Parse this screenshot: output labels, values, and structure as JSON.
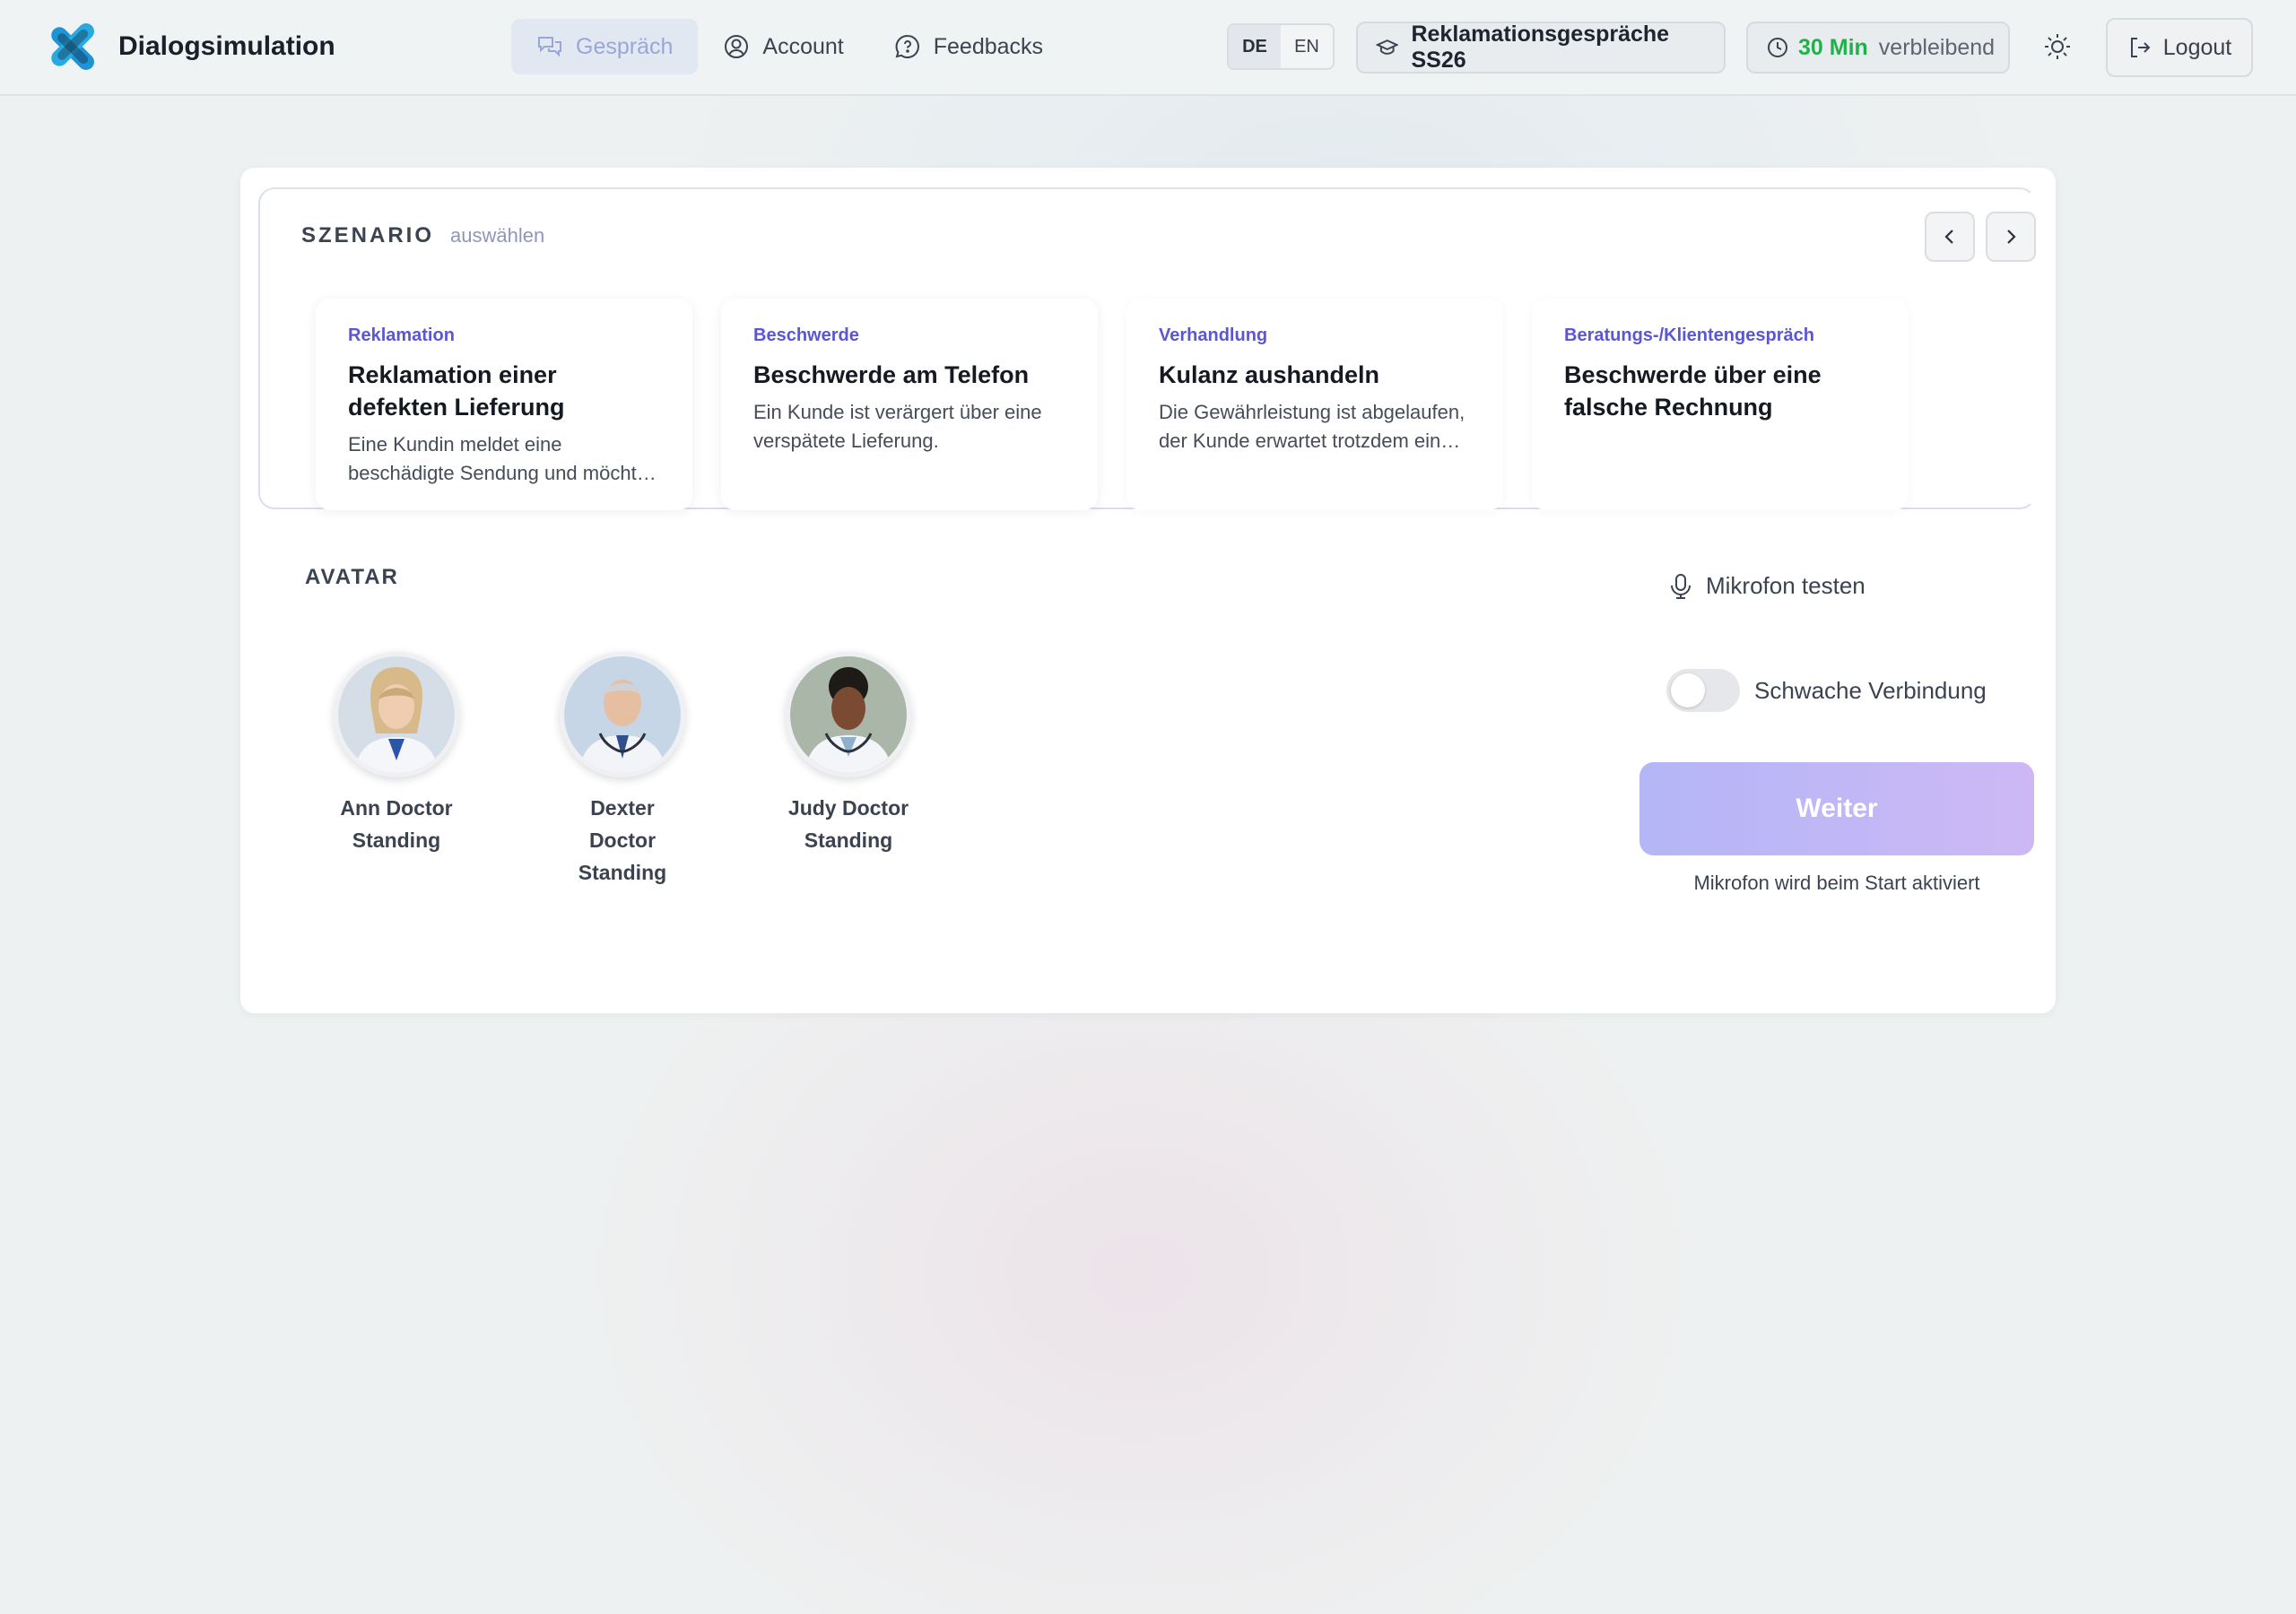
{
  "app": {
    "title": "Dialogsimulation"
  },
  "nav": [
    {
      "label": "Gespräch",
      "icon": "chat-bubbles-icon",
      "active": true
    },
    {
      "label": "Account",
      "icon": "user-circle-icon",
      "active": false
    },
    {
      "label": "Feedbacks",
      "icon": "chat-question-icon",
      "active": false
    }
  ],
  "language": {
    "options": [
      "DE",
      "EN"
    ],
    "selected": "DE"
  },
  "course": {
    "label": "Reklamationsgespräche SS26",
    "icon": "graduation-cap-icon"
  },
  "timer": {
    "value": "30 Min",
    "suffix": "verbleibend",
    "icon": "clock-icon",
    "value_color": "#22b04c"
  },
  "theme_toggle": {
    "icon": "sun-icon"
  },
  "logout": {
    "label": "Logout",
    "icon": "logout-icon"
  },
  "scenario": {
    "title": "SZENARIO",
    "subtitle": "auswählen",
    "cards": [
      {
        "category": "Reklamation",
        "title": "Reklamation einer defekten Lieferung",
        "description": "Eine Kundin meldet eine beschädigte Sendung und möchte eine schnelle Lösung."
      },
      {
        "category": "Beschwerde",
        "title": "Beschwerde am Telefon",
        "description": "Ein Kunde ist verärgert über eine verspätete Lieferung."
      },
      {
        "category": "Verhandlung",
        "title": "Kulanz aushandeln",
        "description": "Die Gewährleistung ist abgelaufen, der Kunde erwartet trotzdem eine Lösung."
      },
      {
        "category": "Beratungs-/Klientengespräch",
        "title": "Beschwerde über eine falsche Rechnung",
        "description": ""
      }
    ]
  },
  "avatar": {
    "title": "AVATAR",
    "items": [
      {
        "name": "Ann Doctor Standing"
      },
      {
        "name": "Dexter Doctor Standing"
      },
      {
        "name": "Judy Doctor Standing"
      }
    ]
  },
  "controls": {
    "mic_test_label": "Mikrofon testen",
    "weak_connection_label": "Schwache Verbindung",
    "weak_connection_on": false,
    "continue_label": "Weiter",
    "hint": "Mikrofon wird beim Start aktiviert"
  },
  "colors": {
    "accent": "#5b56d6",
    "button_gradient_start": "#b4b6f6",
    "button_gradient_end": "#cdb8f5"
  }
}
